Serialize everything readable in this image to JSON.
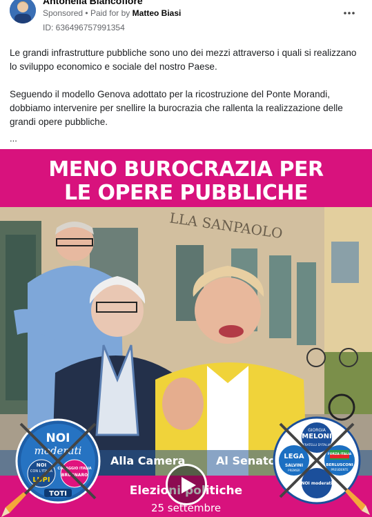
{
  "post": {
    "author": "Antonella Biancofiore",
    "sponsored": "Sponsored",
    "separator": "•",
    "paid_for": "Paid for by",
    "payer": "Matteo Biasi",
    "ad_id": "ID: 636496757991354",
    "paragraph1": "Le grandi infrastrutture pubbliche sono uno dei mezzi attraverso i quali si realizzano lo sviluppo economico e sociale del nostro Paese.",
    "paragraph2": "Seguendo il modello Genova adottato per la ricostruzione del Ponte Morandi, dobbiamo intervenire per snellire la burocrazia che rallenta la realizzazione delle grandi opere pubbliche.",
    "ellipsis": "...",
    "more_icon": "more-horizontal-icon"
  },
  "media": {
    "headline_line1": "MENO BUROCRAZIA PER",
    "headline_line2": "LE OPERE PUBBLICHE",
    "building_sign": "LLA SANPAOLO",
    "label_camera": "Alla Camera",
    "label_senato": "Al Senato",
    "footer_line1": "Elezioni politiche",
    "footer_line2": "25 settembre",
    "play_icon": "play-icon",
    "colors": {
      "magenta": "#d8127d",
      "blue_strip": "#285a96"
    },
    "logo_left": {
      "top_text1": "NOI",
      "top_text2": "moderati",
      "sub1": "NOI",
      "sub2": "CON L'ITALIA",
      "lupi": "LUPI",
      "coraggio": "CORAGGIO ITALIA",
      "brugnaro": "BRUGNARO",
      "toti": "TOTI"
    },
    "logo_right": {
      "giorgia": "GIORGIA",
      "meloni": "MELONI",
      "fdi": "FRATELLI D'ITALIA",
      "lega": "LEGA",
      "salvini": "SALVINI",
      "premier": "PREMIER",
      "forza": "FORZA ITALIA",
      "berlusconi": "BERLUSCONI",
      "presidente": "PRESIDENTE",
      "noimod": "NOI moderati"
    }
  }
}
